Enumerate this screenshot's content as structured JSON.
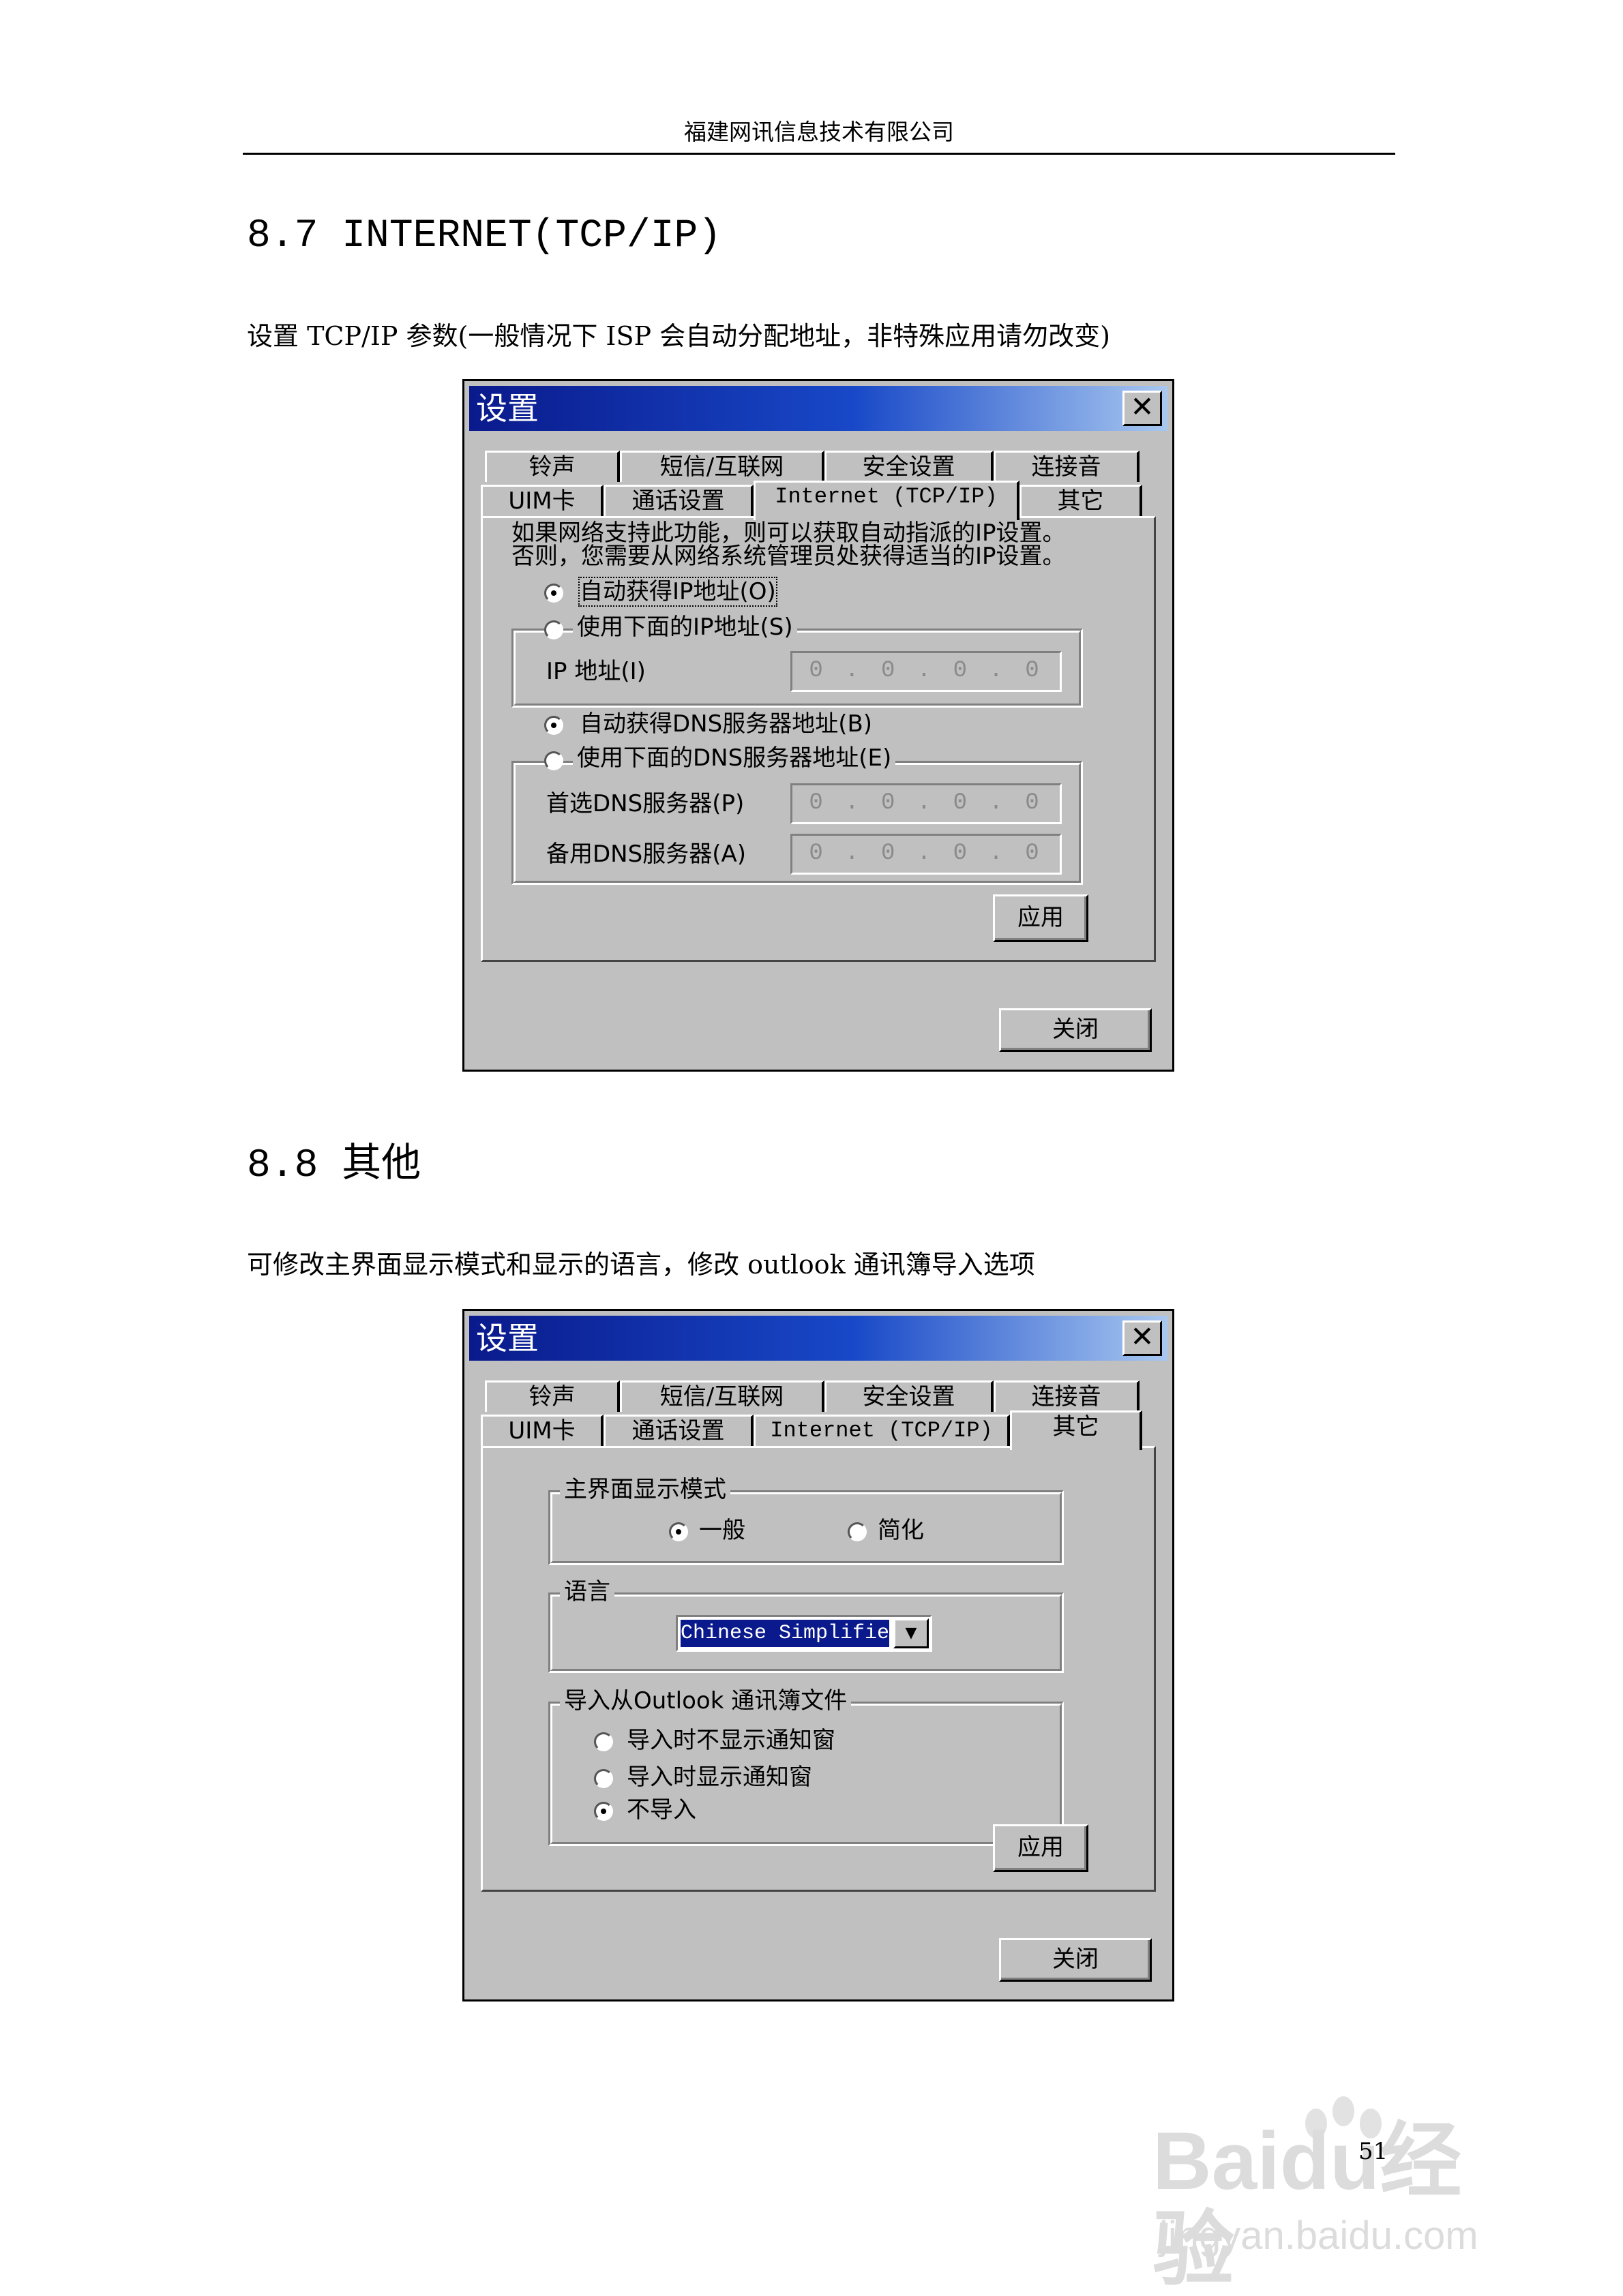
{
  "header": "福建网讯信息技术有限公司",
  "section1": {
    "heading": "8.7 INTERNET(TCP/IP)",
    "desc": "设置 TCP/IP 参数(一般情况下 ISP 会自动分配地址，非特殊应用请勿改变)"
  },
  "section2": {
    "heading": "8.8 其他",
    "desc": "可修改主界面显示模式和显示的语言，修改 outlook 通讯簿导入选项"
  },
  "dialog": {
    "title": "设置",
    "close_glyph": "✕",
    "tabs_row1": [
      "铃声",
      "短信/互联网",
      "安全设置",
      "连接音"
    ],
    "tabs_row2": [
      "UIM卡",
      "通话设置",
      "Internet (TCP/IP)",
      "其它"
    ],
    "apply_label": "应用",
    "close_label": "关闭"
  },
  "tcpip": {
    "intro_line1": "如果网络支持此功能，则可以获取自动指派的IP设置。",
    "intro_line2": "否则，您需要从网络系统管理员处获得适当的IP设置。",
    "auto_ip": "自动获得IP地址(O)",
    "manual_ip": "使用下面的IP地址(S)",
    "ip_label": "IP 地址(I)",
    "ip_value": "0 . 0 . 0 . 0",
    "auto_dns": "自动获得DNS服务器地址(B)",
    "manual_dns": "使用下面的DNS服务器地址(E)",
    "dns1_label": "首选DNS服务器(P)",
    "dns1_value": "0 . 0 . 0 . 0",
    "dns2_label": "备用DNS服务器(A)",
    "dns2_value": "0 . 0 . 0 . 0"
  },
  "other": {
    "mode_group": "主界面显示模式",
    "mode_normal": "一般",
    "mode_simple": "简化",
    "lang_group": "语言",
    "lang_value": "Chinese Simplifie",
    "import_group": "导入从Outlook 通讯簿文件",
    "import_opt1": "导入时不显示通知窗",
    "import_opt2": "导入时显示通知窗",
    "import_opt3": "不导入"
  },
  "page_number": "51",
  "watermark": {
    "logo": "Baidu经验",
    "url": "jingyan.baidu.com"
  }
}
